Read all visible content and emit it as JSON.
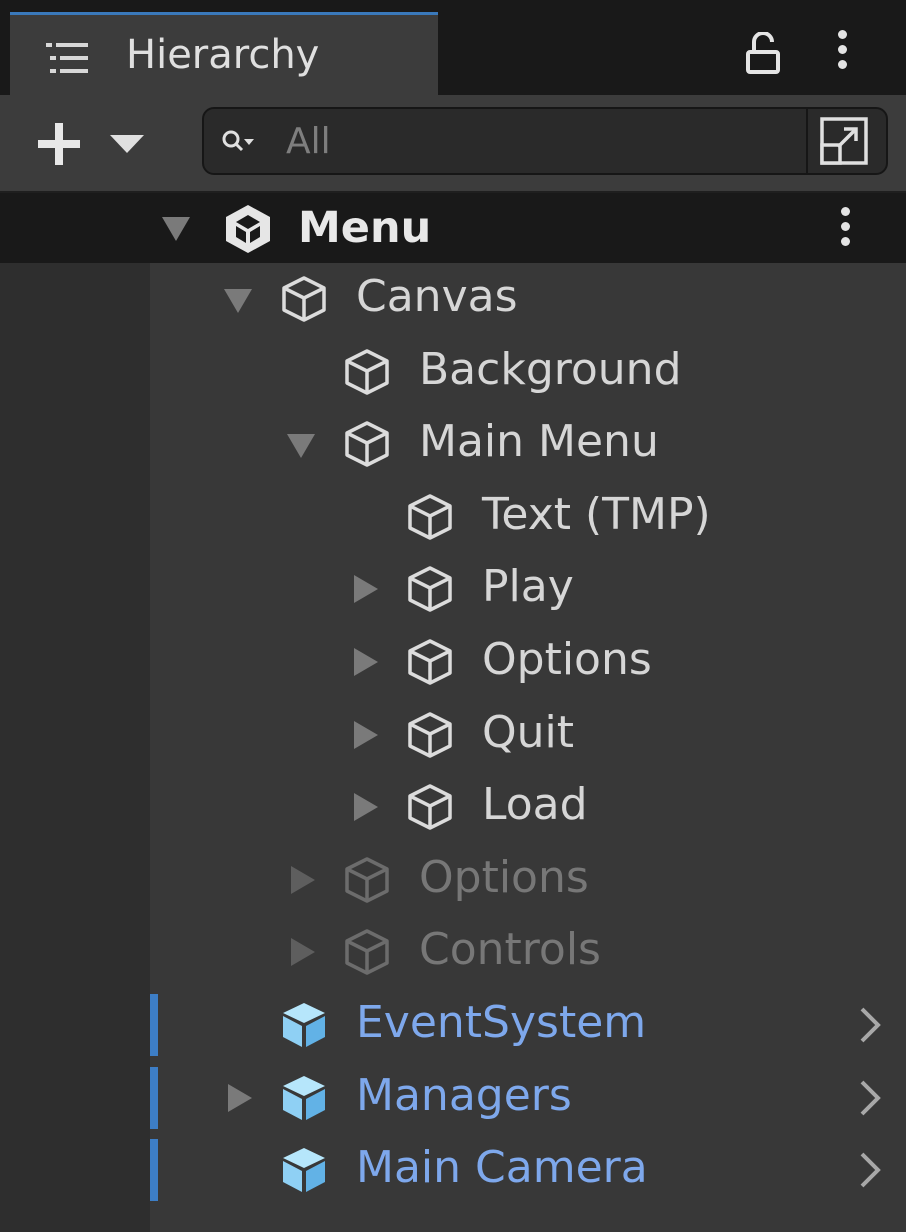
{
  "window": {
    "tab_title": "Hierarchy"
  },
  "toolbar": {
    "search_placeholder": "All"
  },
  "scene": {
    "name": "Menu"
  },
  "tree": [
    {
      "label": "Canvas",
      "depth": 1,
      "expander": "expanded",
      "style": "normal"
    },
    {
      "label": "Background",
      "depth": 2,
      "expander": "none",
      "style": "normal"
    },
    {
      "label": "Main Menu",
      "depth": 2,
      "expander": "expanded",
      "style": "normal"
    },
    {
      "label": "Text (TMP)",
      "depth": 3,
      "expander": "none",
      "style": "normal"
    },
    {
      "label": "Play",
      "depth": 3,
      "expander": "collapsed",
      "style": "normal"
    },
    {
      "label": "Options",
      "depth": 3,
      "expander": "collapsed",
      "style": "normal"
    },
    {
      "label": "Quit",
      "depth": 3,
      "expander": "collapsed",
      "style": "normal"
    },
    {
      "label": "Load",
      "depth": 3,
      "expander": "collapsed",
      "style": "normal"
    },
    {
      "label": "Options",
      "depth": 2,
      "expander": "collapsed",
      "style": "inactive"
    },
    {
      "label": "Controls",
      "depth": 2,
      "expander": "collapsed",
      "style": "inactive"
    },
    {
      "label": "EventSystem",
      "depth": 1,
      "expander": "none",
      "style": "prefab"
    },
    {
      "label": "Managers",
      "depth": 1,
      "expander": "collapsed",
      "style": "prefab"
    },
    {
      "label": "Main Camera",
      "depth": 1,
      "expander": "none",
      "style": "prefab"
    }
  ],
  "colors": {
    "accent_tab": "#3a79bb",
    "prefab_text": "#7ea8ec",
    "prefab_icon": "#8fd0f4",
    "prefab_marker": "#3d7ec6",
    "inactive_text": "#777777"
  }
}
